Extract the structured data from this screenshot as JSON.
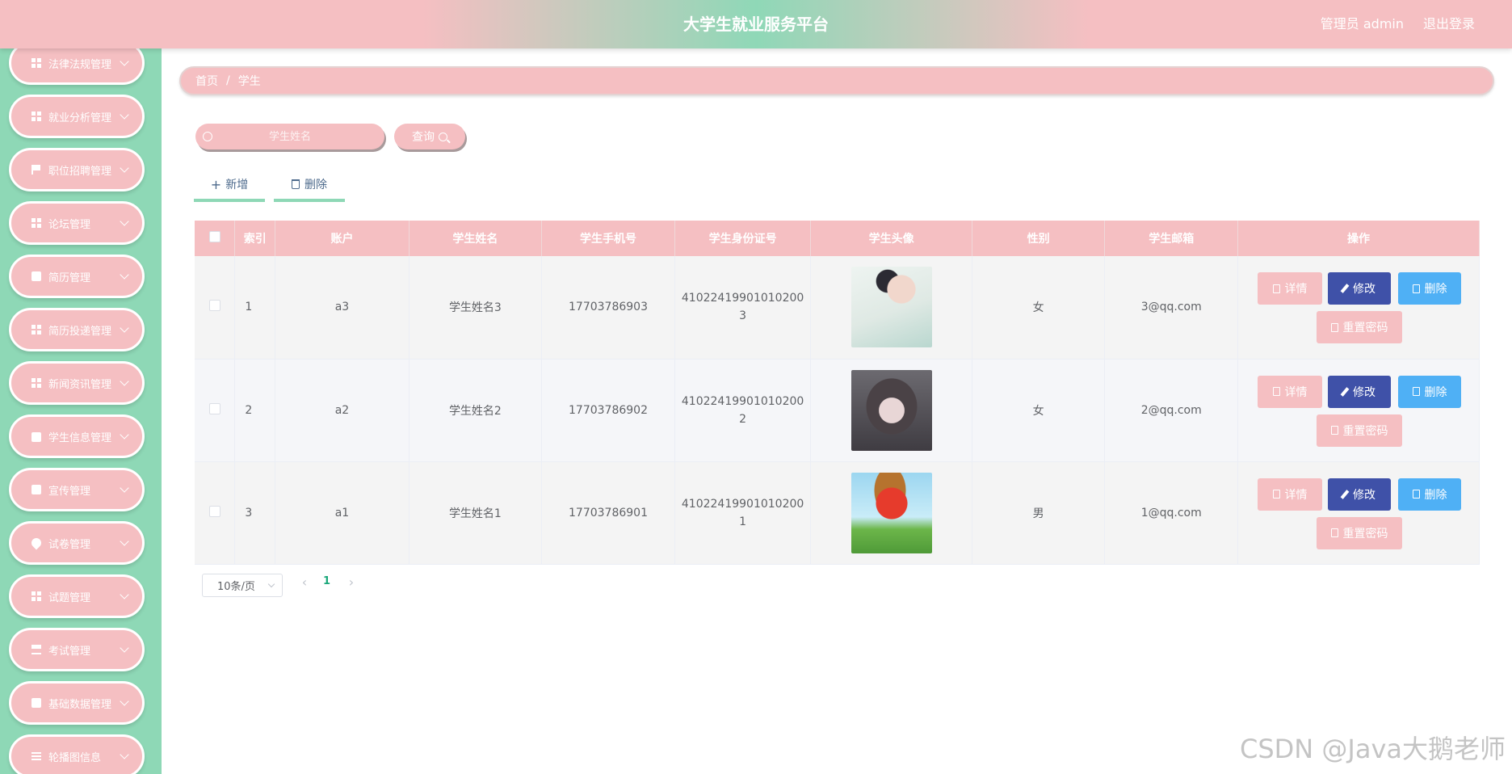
{
  "header": {
    "title": "大学生就业服务平台",
    "user": "管理员 admin",
    "logout": "退出登录"
  },
  "sidebar": {
    "items": [
      {
        "label": "法律法规管理",
        "icon": "grid-icon"
      },
      {
        "label": "就业分析管理",
        "icon": "grid-icon"
      },
      {
        "label": "职位招聘管理",
        "icon": "flag-icon"
      },
      {
        "label": "论坛管理",
        "icon": "grid-icon"
      },
      {
        "label": "简历管理",
        "icon": "document-icon"
      },
      {
        "label": "简历投递管理",
        "icon": "grid-icon"
      },
      {
        "label": "新闻资讯管理",
        "icon": "grid-icon"
      },
      {
        "label": "学生信息管理",
        "icon": "wallet-icon"
      },
      {
        "label": "宣传管理",
        "icon": "check-icon"
      },
      {
        "label": "试卷管理",
        "icon": "pin-icon"
      },
      {
        "label": "试题管理",
        "icon": "grid-icon"
      },
      {
        "label": "考试管理",
        "icon": "stamp-icon"
      },
      {
        "label": "基础数据管理",
        "icon": "chat-icon"
      },
      {
        "label": "轮播图信息",
        "icon": "list-icon"
      }
    ]
  },
  "breadcrumb": {
    "home": "首页",
    "separator": "/",
    "current": "学生"
  },
  "search": {
    "placeholder": "学生姓名",
    "button": "查询"
  },
  "actions": {
    "add": "新增",
    "delete": "删除"
  },
  "table": {
    "columns": [
      "索引",
      "账户",
      "学生姓名",
      "学生手机号",
      "学生身份证号",
      "学生头像",
      "性别",
      "学生邮箱",
      "操作"
    ],
    "rows": [
      {
        "index": "1",
        "account": "a3",
        "name": "学生姓名3",
        "phone": "17703786903",
        "id_line1": "41022419901010200",
        "id_line2": "3",
        "gender": "女",
        "email": "3@qq.com"
      },
      {
        "index": "2",
        "account": "a2",
        "name": "学生姓名2",
        "phone": "17703786902",
        "id_line1": "41022419901010200",
        "id_line2": "2",
        "gender": "女",
        "email": "2@qq.com"
      },
      {
        "index": "3",
        "account": "a1",
        "name": "学生姓名1",
        "phone": "17703786901",
        "id_line1": "41022419901010200",
        "id_line2": "1",
        "gender": "男",
        "email": "1@qq.com"
      }
    ],
    "row_actions": {
      "detail": "详情",
      "edit": "修改",
      "delete": "删除",
      "reset": "重置密码"
    }
  },
  "pagination": {
    "page_size": "10条/页",
    "current_page": "1",
    "prev": "‹",
    "next": "›"
  },
  "watermark": "CSDN @Java大鹅老师",
  "colors": {
    "primary_pink": "#f5bfc2",
    "mint": "#8ed8b6",
    "edit_blue": "#3f51a8",
    "delete_blue": "#4fb0f5",
    "page_green": "#1aa77a"
  }
}
